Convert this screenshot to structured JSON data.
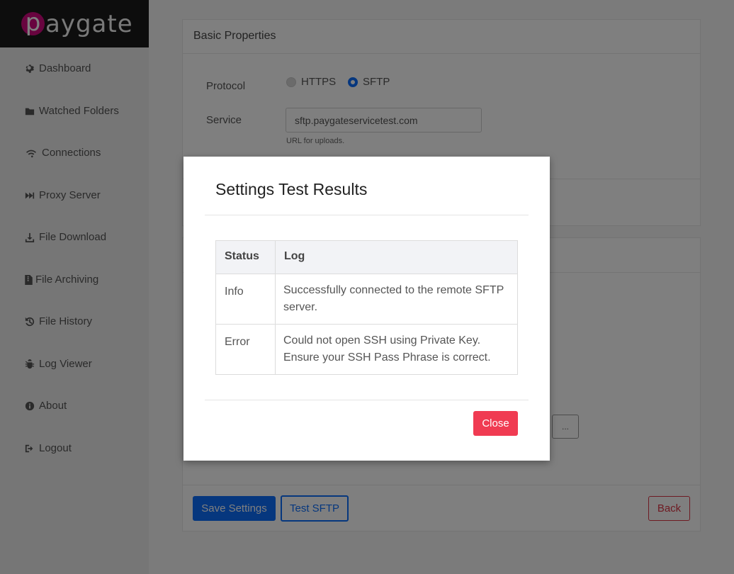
{
  "brand": {
    "logo_initial": "p",
    "logo_rest": "aygate",
    "color": "#d0097f"
  },
  "sidebar": {
    "items": [
      {
        "label": "Dashboard",
        "icon": "gear-icon"
      },
      {
        "label": "Watched Folders",
        "icon": "folder-icon"
      },
      {
        "label": "Connections",
        "icon": "wifi-icon"
      },
      {
        "label": "Proxy Server",
        "icon": "fast-forward-icon"
      },
      {
        "label": "File Download",
        "icon": "download-icon"
      },
      {
        "label": "File Archiving",
        "icon": "file-archive-icon"
      },
      {
        "label": "File History",
        "icon": "history-icon"
      },
      {
        "label": "Log Viewer",
        "icon": "bug-icon"
      },
      {
        "label": "About",
        "icon": "info-icon"
      },
      {
        "label": "Logout",
        "icon": "logout-icon"
      }
    ]
  },
  "basic_properties": {
    "title": "Basic Properties",
    "protocol_label": "Protocol",
    "protocol_options": [
      "HTTPS",
      "SFTP"
    ],
    "protocol_selected": "SFTP",
    "service_label": "Service",
    "service_value": "sftp.paygateservicetest.com",
    "service_help": "URL for uploads."
  },
  "second_card": {
    "browse_label": "..."
  },
  "footer": {
    "save_label": "Save Settings",
    "test_label": "Test SFTP",
    "back_label": "Back"
  },
  "modal": {
    "title": "Settings Test Results",
    "columns": [
      "Status",
      "Log"
    ],
    "rows": [
      {
        "status": "Info",
        "log_line1": "Successfully connected to the remote SFTP",
        "log_line2": "server."
      },
      {
        "status": "Error",
        "log_line1": "Could not open SSH using Private Key.",
        "log_line2": "Ensure your SSH Pass Phrase is correct."
      }
    ],
    "close_label": "Close"
  },
  "colors": {
    "primary": "#0d6efd",
    "danger": "#dc3545",
    "close": "#f03b52"
  }
}
